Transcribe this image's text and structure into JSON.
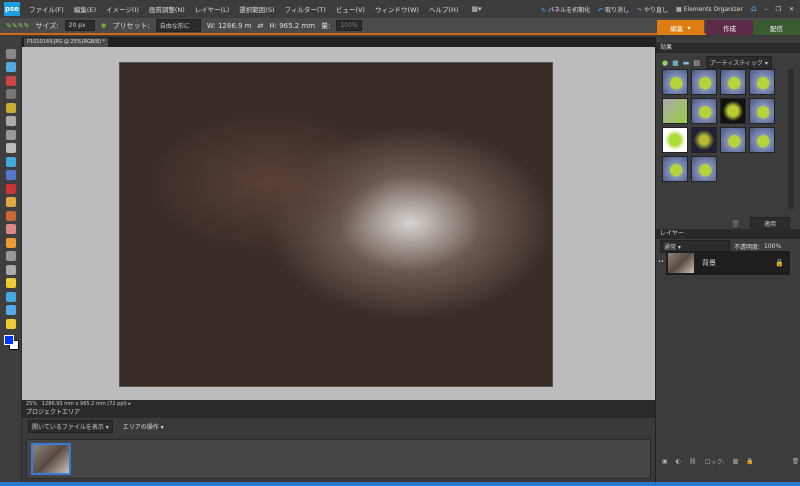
{
  "app": {
    "logo": "pse"
  },
  "menu": [
    "ファイル(F)",
    "編集(E)",
    "イメージ(I)",
    "画質調整(N)",
    "レイヤー(L)",
    "選択範囲(S)",
    "フィルター(T)",
    "ビュー(V)",
    "ウィンドウ(W)",
    "ヘルプ(H)"
  ],
  "top_right": {
    "reset_panels": "パネルを初期化",
    "undo": "取り消し",
    "redo": "やり直し",
    "organizer": "Elements Organizer"
  },
  "options": {
    "size_label": "サイズ:",
    "size_value": "20 px",
    "preset_label": "プリセット:",
    "preset_value": "自由な形に",
    "w": "W: 1286.9 m",
    "h": "H: 965.2 mm",
    "amount_label": "量:",
    "amount_value": "100%"
  },
  "modes": {
    "edit": "編集",
    "create": "作成",
    "share": "配信"
  },
  "document": {
    "tab": "P1010149.JPG @ 25%(RGB/8) *",
    "zoom": "25%",
    "info": "1286.93 mm x 965.2 mm (72 ppi)"
  },
  "project": {
    "title": "プロジェクトエリア",
    "show": "開いているファイルを表示",
    "ops": "エリアの操作"
  },
  "effects": {
    "title": "効果",
    "category": "アーティスティック",
    "apply": "適用",
    "thumbs": 14
  },
  "layers": {
    "title": "レイヤー",
    "blend": "通常",
    "opacity_label": "不透明度:",
    "opacity": "100%",
    "layer_name": "背景",
    "lock": "ロック:"
  }
}
